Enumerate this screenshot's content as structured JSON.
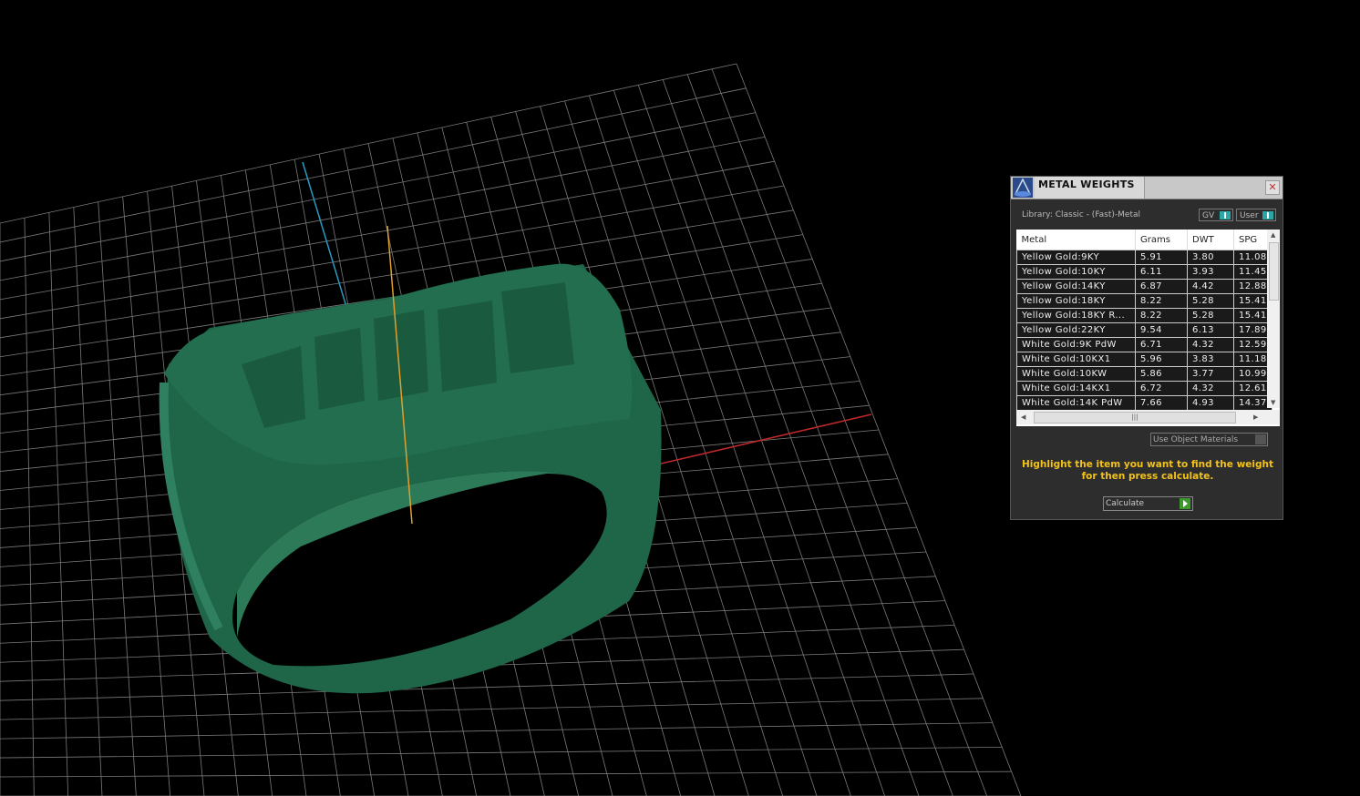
{
  "panel": {
    "title": "METAL WEIGHTS",
    "close": "✕",
    "library": "Library: Classic - (Fast)-Metal",
    "toggle_gv": "GV",
    "toggle_user": "User",
    "columns": [
      "Metal",
      "Grams",
      "DWT",
      "SPG"
    ],
    "rows": [
      [
        "Yellow Gold:9KY",
        "5.91",
        "3.80",
        "11.08"
      ],
      [
        "Yellow Gold:10KY",
        "6.11",
        "3.93",
        "11.45"
      ],
      [
        "Yellow Gold:14KY",
        "6.87",
        "4.42",
        "12.88"
      ],
      [
        "Yellow Gold:18KY",
        "8.22",
        "5.28",
        "15.41"
      ],
      [
        "Yellow Gold:18KY R...",
        "8.22",
        "5.28",
        "15.41"
      ],
      [
        "Yellow Gold:22KY",
        "9.54",
        "6.13",
        "17.89"
      ],
      [
        "White Gold:9K PdW",
        "6.71",
        "4.32",
        "12.59"
      ],
      [
        "White Gold:10KX1",
        "5.96",
        "3.83",
        "11.18"
      ],
      [
        "White Gold:10KW",
        "5.86",
        "3.77",
        "10.99"
      ],
      [
        "White Gold:14KX1",
        "6.72",
        "4.32",
        "12.61"
      ],
      [
        "White Gold:14K PdW",
        "7.66",
        "4.93",
        "14.37"
      ]
    ],
    "use_object_materials": "Use Object Materials",
    "hint": "Highlight the item you want to find the weight for then press calculate.",
    "calculate": "Calculate"
  },
  "colors": {
    "ring": "#1f6a4a",
    "grid": "#8a8a8a",
    "x_axis": "#c0282a",
    "y_axis": "#2a9ac0",
    "z_axis": "#e0a030",
    "hint": "#f2c21b"
  }
}
